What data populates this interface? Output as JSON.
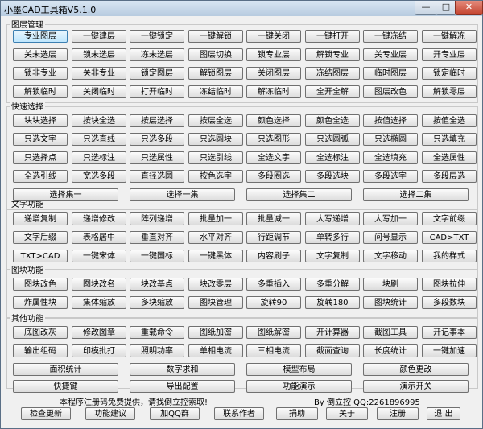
{
  "window": {
    "title": "小墨CAD工具箱V5.1.0",
    "min": "—",
    "max": "□",
    "close": "✕"
  },
  "sections": [
    {
      "label": "图层管理",
      "rows": [
        [
          "专业图层",
          "一键建层",
          "一键锁定",
          "一键解锁",
          "一键关闭",
          "一键打开",
          "一键冻结",
          "一键解冻"
        ],
        [
          "关未选层",
          "锁未选层",
          "冻未选层",
          "图层切换",
          "锁专业层",
          "解锁专业",
          "关专业层",
          "开专业层"
        ],
        [
          "锁非专业",
          "关非专业",
          "锁定图层",
          "解锁图层",
          "关闭图层",
          "冻结图层",
          "临时图层",
          "锁定临时"
        ],
        [
          "解锁临时",
          "关闭临时",
          "打开临时",
          "冻结临时",
          "解冻临时",
          "全开全解",
          "图层改色",
          "解锁零层"
        ]
      ]
    },
    {
      "label": "快速选择",
      "rows": [
        [
          "块块选择",
          "按块全选",
          "按层选择",
          "按层全选",
          "颜色选择",
          "颜色全选",
          "按值选择",
          "按值全选"
        ],
        [
          "只选文字",
          "只选直线",
          "只选多段",
          "只选圆块",
          "只选图形",
          "只选圆弧",
          "只选椭圆",
          "只选填充"
        ],
        [
          "只选择点",
          "只选标注",
          "只选属性",
          "只选引线",
          "全选文字",
          "全选标注",
          "全选填充",
          "全选属性"
        ],
        [
          "全选引线",
          "宽选多段",
          "直径选圆",
          "按色选字",
          "多段圈选",
          "多段选块",
          "多段选字",
          "多段层选"
        ],
        [
          "选择集一",
          "选择一集",
          "选择集二",
          "选择二集"
        ]
      ]
    },
    {
      "label": "文字功能",
      "rows": [
        [
          "递增复制",
          "递增修改",
          "阵列递增",
          "批量加一",
          "批量减一",
          "大写递增",
          "大写加一",
          "文字前缀"
        ],
        [
          "文字后缀",
          "表格居中",
          "垂直对齐",
          "水平对齐",
          "行距调节",
          "单转多行",
          "问号显示",
          "CAD>TXT"
        ],
        [
          "TXT>CAD",
          "一键宋体",
          "一键国标",
          "一键黑体",
          "内容刷子",
          "文字复制",
          "文字移动",
          "我的样式"
        ]
      ]
    },
    {
      "label": "图块功能",
      "rows": [
        [
          "图块改色",
          "图块改名",
          "块改基点",
          "块改零层",
          "多重插入",
          "多重分解",
          "块刷",
          "图块拉伸"
        ],
        [
          "炸属性块",
          "集体缩放",
          "多块缩放",
          "图块管理",
          "旋转90",
          "旋转180",
          "图块统计",
          "多段数块"
        ]
      ]
    },
    {
      "label": "其他功能",
      "rows": [
        [
          "底图改灰",
          "修改图章",
          "重载命令",
          "图纸加密",
          "图纸解密",
          "开计算器",
          "截图工具",
          "开记事本"
        ],
        [
          "输出组码",
          "印模批打",
          "照明功率",
          "单相电流",
          "三相电流",
          "截面查询",
          "长度统计",
          "一键加速"
        ],
        [
          "面积统计",
          "数字求和",
          "模型布局",
          "颜色更改"
        ]
      ]
    }
  ],
  "bottom_row": [
    "快捷键",
    "导出配置",
    "功能演示",
    "演示开关"
  ],
  "notice": "本程序注册码免费提供，请找倒立控索取!",
  "author": "By 倒立控 QQ:2261896995",
  "footer_buttons": [
    "检查更新",
    "功能建议",
    "加QQ群",
    "联系作者",
    "捐助",
    "关于",
    "注册",
    "退 出"
  ]
}
